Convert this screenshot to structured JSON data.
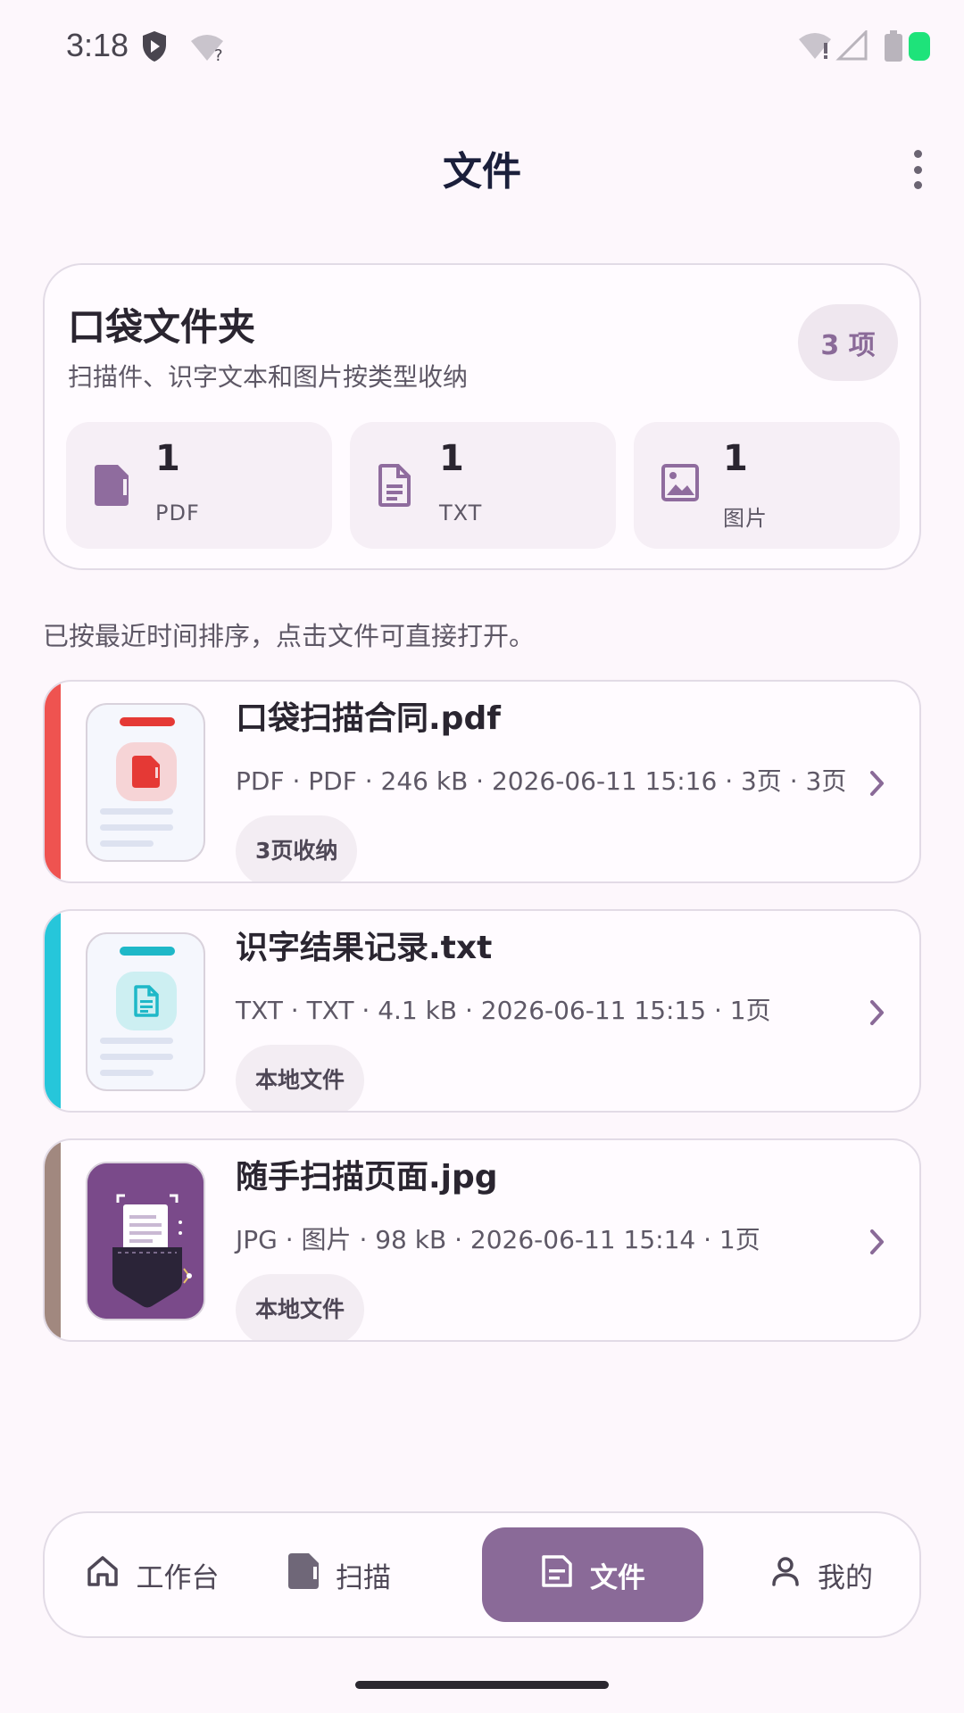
{
  "status_bar": {
    "time": "3:18"
  },
  "header": {
    "title": "文件"
  },
  "summary": {
    "title": "口袋文件夹",
    "subtitle": "扫描件、识字文本和图片按类型收纳",
    "count_badge": "3 项",
    "stats": [
      {
        "count": "1",
        "label": "PDF",
        "icon": "pdf-file-icon"
      },
      {
        "count": "1",
        "label": "TXT",
        "icon": "text-file-icon"
      },
      {
        "count": "1",
        "label": "图片",
        "icon": "image-icon"
      }
    ]
  },
  "hint": "已按最近时间排序，点击文件可直接打开。",
  "files": [
    {
      "name": "口袋扫描合同.pdf",
      "meta": "PDF · PDF · 246 kB · 2026-06-11 15:16 · 3页 · 3页",
      "tag": "3页收纳",
      "accent_color": "#ef5350"
    },
    {
      "name": "识字结果记录.txt",
      "meta": "TXT · TXT · 4.1 kB · 2026-06-11 15:15 · 1页",
      "tag": "本地文件",
      "accent_color": "#26c6da"
    },
    {
      "name": "随手扫描页面.jpg",
      "meta": "JPG · 图片 · 98 kB · 2026-06-11 15:14 · 1页",
      "tag": "本地文件",
      "accent_color": "#a1887f"
    }
  ],
  "nav": {
    "items": [
      {
        "label": "工作台",
        "icon": "home-icon"
      },
      {
        "label": "扫描",
        "icon": "scan-icon"
      },
      {
        "label": "文件",
        "icon": "files-icon",
        "active": true
      },
      {
        "label": "我的",
        "icon": "person-icon"
      }
    ]
  },
  "colors": {
    "primary": "#8a6a98",
    "background": "#fdf7fc"
  }
}
